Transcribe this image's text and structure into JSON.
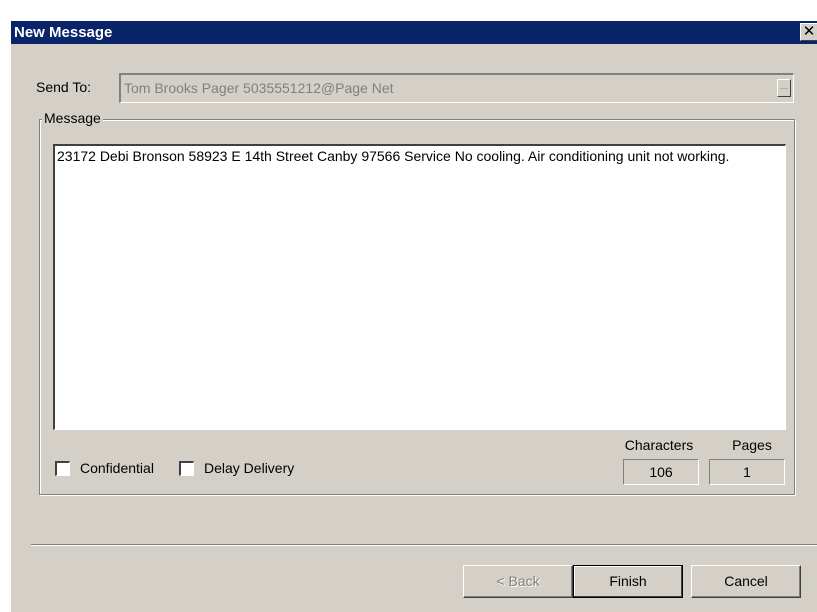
{
  "window": {
    "title": "New Message",
    "close_glyph": "✕"
  },
  "send_to": {
    "label": "Send To:",
    "value": "Tom Brooks Pager  5035551212@Page Net",
    "browse_label": "..."
  },
  "message": {
    "group_label": "Message",
    "text": "23172 Debi Bronson 58923 E 14th Street Canby 97566 Service No cooling.  Air conditioning unit not working."
  },
  "options": {
    "confidential_label": "Confidential",
    "confidential_checked": false,
    "delay_label": "Delay Delivery",
    "delay_checked": false
  },
  "counters": {
    "characters_label": "Characters",
    "characters_value": "106",
    "pages_label": "Pages",
    "pages_value": "1"
  },
  "buttons": {
    "back": "< Back",
    "finish": "Finish",
    "cancel": "Cancel"
  }
}
